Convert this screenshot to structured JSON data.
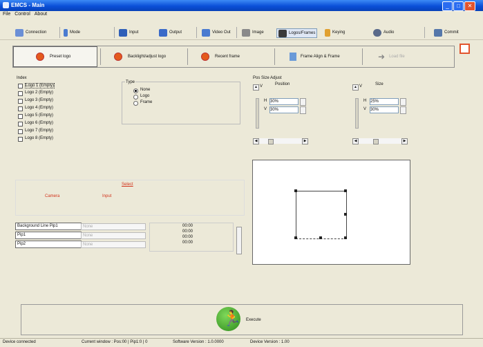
{
  "window": {
    "title": "EMCS - Main"
  },
  "menu": [
    "File",
    "Control",
    "About"
  ],
  "toolbar": [
    {
      "label": "Connection",
      "color": "#6b8fd6"
    },
    {
      "label": "Mode",
      "color": "#4a7bd0"
    },
    {
      "label": "Input",
      "color": "#2f5fb8"
    },
    {
      "label": "Output",
      "color": "#3a6ac8"
    },
    {
      "label": "Video Out",
      "color": "#4a7bd0"
    },
    {
      "label": "Image",
      "color": "#8a8a8a"
    },
    {
      "label": "Logos/Frames",
      "color": "#3a3a3a"
    },
    {
      "label": "Keying",
      "color": "#e0a030"
    },
    {
      "label": "Audio",
      "color": "#5a6a8a"
    },
    {
      "label": "Commit",
      "color": "#5577aa"
    }
  ],
  "tabs": [
    "Preset logo",
    "Backlight/adjust logo",
    "Recent frame",
    "Frame Align & Frame",
    "Load file"
  ],
  "logos": {
    "group_label": "Index",
    "items": [
      "Logo 1 (Empty)",
      "Logo 2 (Empty)",
      "Logo 3 (Empty)",
      "Logo 4 (Empty)",
      "Logo 5 (Empty)",
      "Logo 6 (Empty)",
      "Logo 7 (Empty)",
      "Logo 8 (Empty)"
    ]
  },
  "type": {
    "group_label": "Type",
    "options": [
      "None",
      "Logo",
      "Frame"
    ],
    "selected": 0
  },
  "select": {
    "title": "Select",
    "left": "Camera",
    "right": "Input"
  },
  "grid": {
    "rows": [
      {
        "label": "Background Line Pip1",
        "value": "None",
        "code": "00:00"
      },
      {
        "label": "Pip1",
        "value": "None",
        "code": "00:00"
      },
      {
        "label": "Pip2",
        "value": "None",
        "code": "00:00"
      }
    ],
    "extra_code": "00:00"
  },
  "pos_adjust": {
    "title": "Pos Size Adjust",
    "position_label": "Position",
    "size_label": "Size",
    "pos_h": "30%",
    "pos_v": "30%",
    "size_h": "25%",
    "size_v": "30%",
    "h_label": "H",
    "v_label": "V"
  },
  "execute_label": "Execute",
  "status": [
    "Device connected",
    "Current window : Pos:00 | Pip1:0 | 0",
    "Software Version : 1.0.0000",
    "Device Version : 1.00"
  ]
}
